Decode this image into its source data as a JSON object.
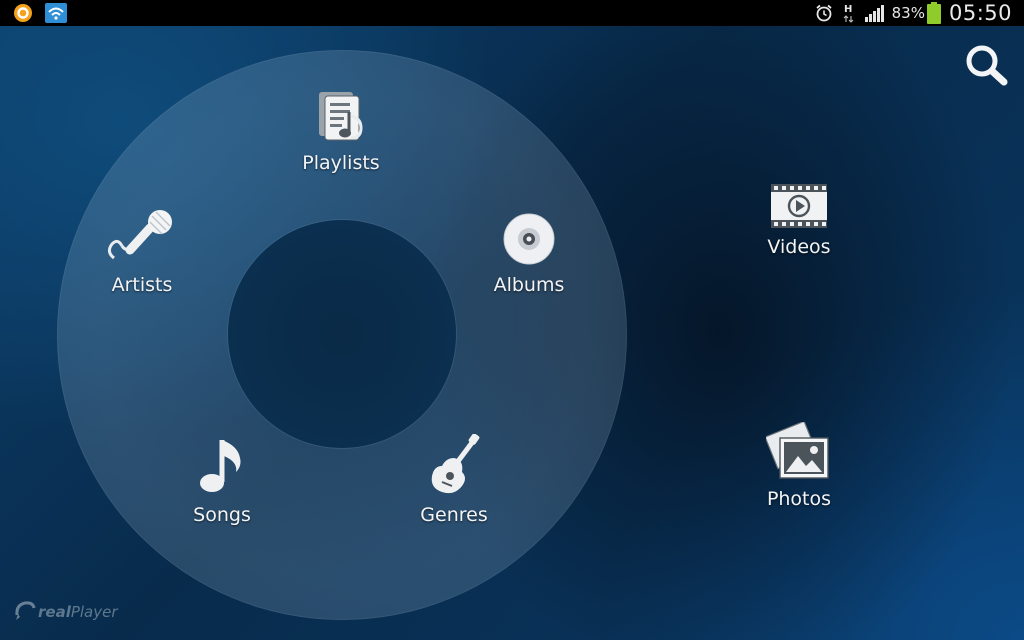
{
  "status_bar": {
    "battery_percent": "83%",
    "clock": "05:50",
    "network_type": "H"
  },
  "main_menu": {
    "playlists": "Playlists",
    "artists": "Artists",
    "albums": "Albums",
    "songs": "Songs",
    "genres": "Genres"
  },
  "side_menu": {
    "videos": "Videos",
    "photos": "Photos"
  },
  "brand": {
    "name_bold": "real",
    "name_rest": "Player"
  },
  "colors": {
    "accent_orange": "#f4a21c",
    "battery_green": "#8fcb2a",
    "wifi_blue": "#2f8fd6"
  }
}
